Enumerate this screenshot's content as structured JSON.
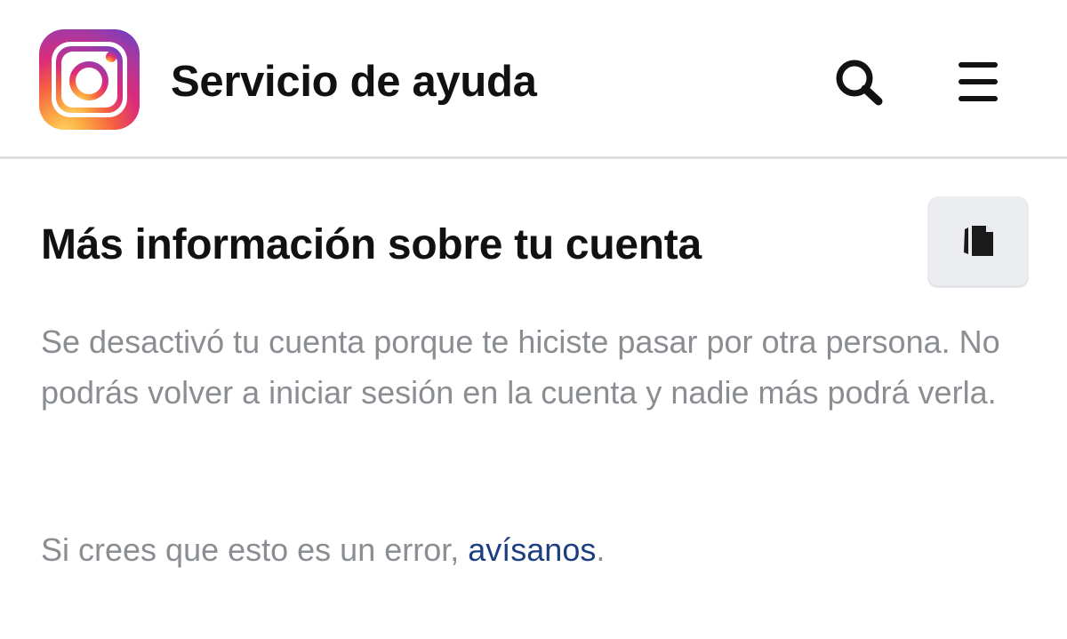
{
  "header": {
    "logo_icon": "instagram-logo-icon",
    "title": "Servicio de ayuda",
    "search_icon": "search-icon",
    "menu_icon": "hamburger-menu-icon"
  },
  "article": {
    "title": "Más información sobre tu cuenta",
    "copy_icon": "copy-icon",
    "paragraph1": "Se desactivó tu cuenta porque te hiciste pasar por otra persona. No podrás volver a iniciar sesión en la cuenta y nadie más podrá verla.",
    "paragraph2_prefix": "Si crees que esto es un error, ",
    "paragraph2_link": "avísanos",
    "paragraph2_suffix": "."
  },
  "colors": {
    "title_text": "#111111",
    "body_text": "#8a8d91",
    "link": "#1d3f7f",
    "divider": "#dedee2",
    "button_bg": "#ebedf0"
  }
}
